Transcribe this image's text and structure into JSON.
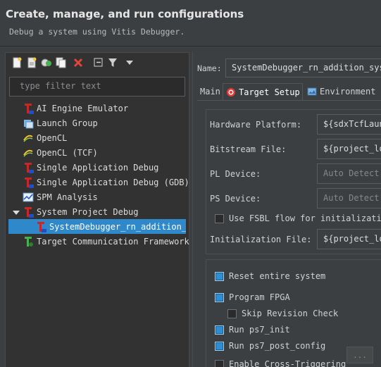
{
  "header": {
    "title": "Create, manage, and run configurations",
    "subtitle": "Debug a system using Vitis Debugger."
  },
  "filter": {
    "placeholder": "type filter text"
  },
  "tree": {
    "items": [
      {
        "label": "AI Engine Emulator",
        "icon": "tcf-red-icon"
      },
      {
        "label": "Launch Group",
        "icon": "launch-group-icon"
      },
      {
        "label": "OpenCL",
        "icon": "opencl-icon"
      },
      {
        "label": "OpenCL (TCF)",
        "icon": "opencl-icon"
      },
      {
        "label": "Single Application Debug",
        "icon": "tcf-red-icon"
      },
      {
        "label": "Single Application Debug (GDB)",
        "icon": "tcf-red-icon"
      },
      {
        "label": "SPM Analysis",
        "icon": "spm-chart-icon"
      },
      {
        "label": "System Project Debug",
        "icon": "tcf-red-icon"
      },
      {
        "label": "SystemDebugger_rn_addition_system",
        "icon": "tcf-red-icon"
      },
      {
        "label": "Target Communication Framework",
        "icon": "tcf-green-icon"
      }
    ]
  },
  "name_label": "Name:",
  "name_value": "SystemDebugger_rn_addition_system",
  "tabs": [
    {
      "label": "Main"
    },
    {
      "label": "Target Setup"
    },
    {
      "label": "Environment"
    }
  ],
  "fields": {
    "hardware_platform": {
      "label": "Hardware Platform:",
      "value": "${sdxTcfLaunch"
    },
    "bitstream_file": {
      "label": "Bitstream File:",
      "value": "${project_loc"
    },
    "pl_device": {
      "label": "PL Device:",
      "value": "Auto Detect"
    },
    "ps_device": {
      "label": "PS Device:",
      "value": "Auto Detect"
    },
    "fsbl": {
      "label": "Use FSBL flow for initialization",
      "checked": false
    },
    "init_file": {
      "label": "Initialization File:",
      "value": "${project_loc"
    }
  },
  "options": {
    "reset_system": {
      "label": "Reset entire system",
      "checked": true
    },
    "program_fpga": {
      "label": "Program FPGA",
      "checked": true
    },
    "skip_revision": {
      "label": "Skip Revision Check",
      "checked": false
    },
    "run_ps7_init": {
      "label": "Run ps7_init",
      "checked": true
    },
    "run_ps7_post_config": {
      "label": "Run ps7_post_config",
      "checked": true
    },
    "cross_triggering": {
      "label": "Enable Cross-Triggering",
      "checked": false
    },
    "cross_triggering_btn": "..."
  },
  "colors": {
    "accent": "#2e88c9",
    "background": "#3c3f41",
    "panel": "#323232"
  }
}
